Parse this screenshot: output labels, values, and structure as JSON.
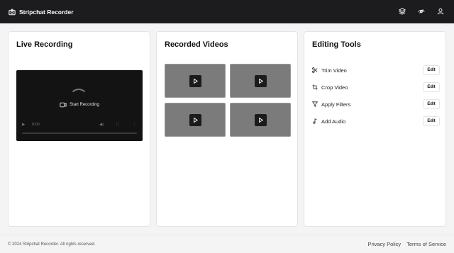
{
  "header": {
    "app_title": "Stripchat Recorder",
    "icons": [
      "camera-icon",
      "layers-icon",
      "view-toggle-icon",
      "user-icon"
    ]
  },
  "panels": {
    "live": {
      "title": "Live Recording",
      "start_label": "Start Recording",
      "time": "0:00"
    },
    "recorded": {
      "title": "Recorded Videos",
      "thumbnails": 4
    },
    "tools": {
      "title": "Editing Tools",
      "items": [
        {
          "label": "Trim Video",
          "icon": "scissors-icon",
          "action": "Edit"
        },
        {
          "label": "Crop Video",
          "icon": "crop-icon",
          "action": "Edit"
        },
        {
          "label": "Apply Filters",
          "icon": "filter-icon",
          "action": "Edit"
        },
        {
          "label": "Add Audio",
          "icon": "music-note-icon",
          "action": "Edit"
        }
      ]
    }
  },
  "footer": {
    "copyright": "© 2024 Stripchat Recorder. All rights reserved.",
    "links": [
      "Privacy Policy",
      "Terms of Service"
    ]
  },
  "colors": {
    "topbar": "#1c1c1e",
    "page_bg": "#f4f4f5",
    "thumbnail": "#7b7b7b",
    "player_bg": "#131313"
  }
}
